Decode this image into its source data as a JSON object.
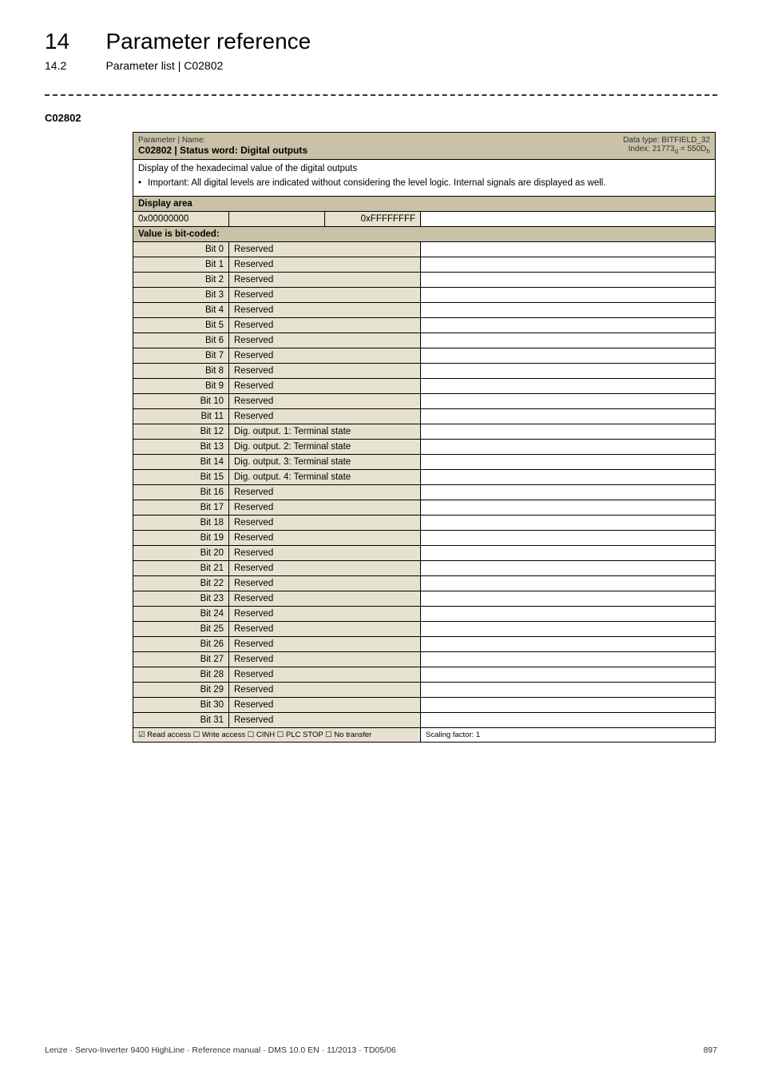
{
  "chapter": {
    "num": "14",
    "title": "Parameter reference"
  },
  "section": {
    "num": "14.2",
    "title": "Parameter list | C02802"
  },
  "param_id": "C02802",
  "header": {
    "pn_label": "Parameter | Name:",
    "title": "C02802 | Status word: Digital outputs",
    "datatype": "Data type: BITFIELD_32",
    "index": "Index: 21773",
    "index_sub_d": "d",
    "index_eq": " = 550D",
    "index_sub_h": "h"
  },
  "description": {
    "main": "Display of the hexadecimal value of the digital outputs",
    "bullet": "Important: All digital levels are indicated without considering the level logic. Internal signals are displayed as well."
  },
  "display_area": {
    "label": "Display area",
    "min": "0x00000000",
    "max": "0xFFFFFFFF"
  },
  "bit_header": "Value is bit-coded:",
  "bits": [
    {
      "label": "Bit 0",
      "value": "Reserved"
    },
    {
      "label": "Bit 1",
      "value": "Reserved"
    },
    {
      "label": "Bit 2",
      "value": "Reserved"
    },
    {
      "label": "Bit 3",
      "value": "Reserved"
    },
    {
      "label": "Bit 4",
      "value": "Reserved"
    },
    {
      "label": "Bit 5",
      "value": "Reserved"
    },
    {
      "label": "Bit 6",
      "value": "Reserved"
    },
    {
      "label": "Bit 7",
      "value": "Reserved"
    },
    {
      "label": "Bit 8",
      "value": "Reserved"
    },
    {
      "label": "Bit 9",
      "value": "Reserved"
    },
    {
      "label": "Bit 10",
      "value": "Reserved"
    },
    {
      "label": "Bit 11",
      "value": "Reserved"
    },
    {
      "label": "Bit 12",
      "value": "Dig. output. 1: Terminal state"
    },
    {
      "label": "Bit 13",
      "value": "Dig. output. 2: Terminal state"
    },
    {
      "label": "Bit 14",
      "value": "Dig. output. 3: Terminal state"
    },
    {
      "label": "Bit 15",
      "value": "Dig. output. 4: Terminal state"
    },
    {
      "label": "Bit 16",
      "value": "Reserved"
    },
    {
      "label": "Bit 17",
      "value": "Reserved"
    },
    {
      "label": "Bit 18",
      "value": "Reserved"
    },
    {
      "label": "Bit 19",
      "value": "Reserved"
    },
    {
      "label": "Bit 20",
      "value": "Reserved"
    },
    {
      "label": "Bit 21",
      "value": "Reserved"
    },
    {
      "label": "Bit 22",
      "value": "Reserved"
    },
    {
      "label": "Bit 23",
      "value": "Reserved"
    },
    {
      "label": "Bit 24",
      "value": "Reserved"
    },
    {
      "label": "Bit 25",
      "value": "Reserved"
    },
    {
      "label": "Bit 26",
      "value": "Reserved"
    },
    {
      "label": "Bit 27",
      "value": "Reserved"
    },
    {
      "label": "Bit 28",
      "value": "Reserved"
    },
    {
      "label": "Bit 29",
      "value": "Reserved"
    },
    {
      "label": "Bit 30",
      "value": "Reserved"
    },
    {
      "label": "Bit 31",
      "value": "Reserved"
    }
  ],
  "access_flags": "☑ Read access   ☐ Write access   ☐ CINH   ☐ PLC STOP   ☐ No transfer",
  "scaling": "Scaling factor: 1",
  "footer": {
    "left": "Lenze · Servo-Inverter 9400 HighLine · Reference manual · DMS 10.0 EN · 11/2013 · TD05/06",
    "right": "897"
  }
}
